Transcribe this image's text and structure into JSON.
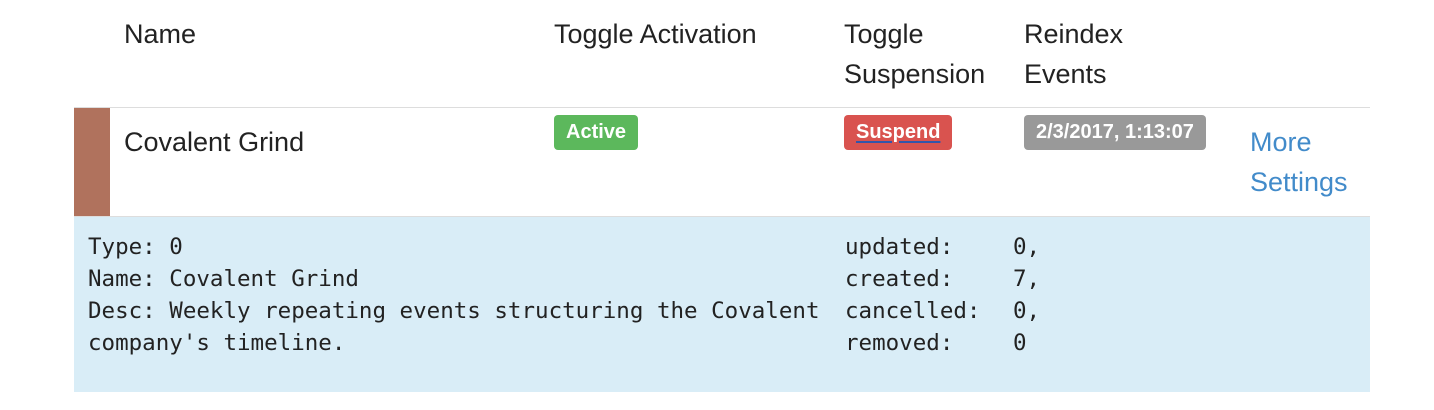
{
  "colors": {
    "row_swatch": "#b0725d",
    "active": "#5cb85c",
    "suspend": "#d9534f",
    "date": "#999999",
    "link": "#428bca",
    "details_bg": "#d9edf7"
  },
  "header": {
    "name": "Name",
    "toggle_activation": "Toggle Activation",
    "toggle_suspension_line1": "Toggle",
    "toggle_suspension_line2": "Suspension",
    "reindex_line1": "Reindex",
    "reindex_line2": "Events"
  },
  "row": {
    "name": "Covalent Grind",
    "active_label": "Active",
    "suspend_label": "Suspend",
    "reindex_date": "2/3/2017, 1:13:07",
    "more_line1": "More",
    "more_line2": "Settings"
  },
  "details": {
    "type_line": "Type: 0",
    "name_line": "Name: Covalent Grind",
    "desc_line": "Desc: Weekly repeating events structuring the Covalent company's timeline.",
    "stats": [
      {
        "label": "updated:",
        "value": "0,"
      },
      {
        "label": "created:",
        "value": "7,"
      },
      {
        "label": "cancelled:",
        "value": "0,"
      },
      {
        "label": "removed:",
        "value": "0"
      }
    ]
  }
}
